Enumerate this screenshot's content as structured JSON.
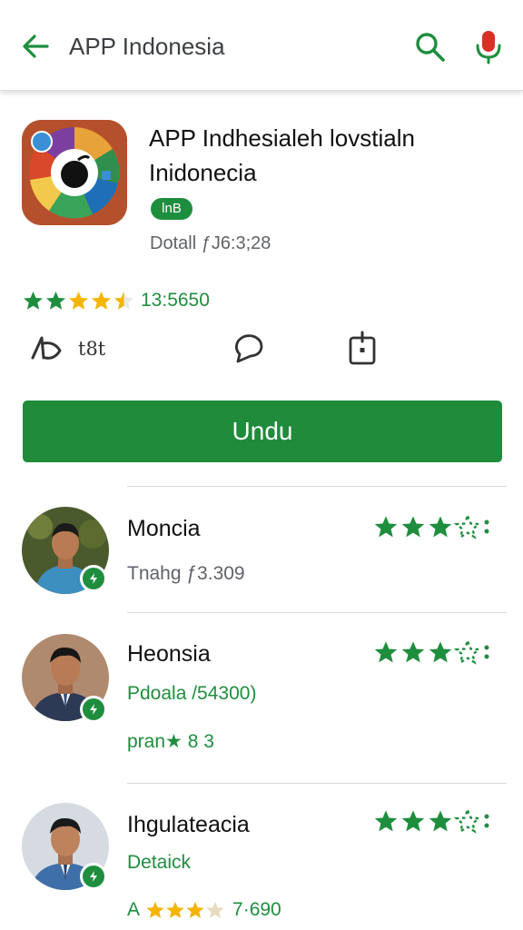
{
  "appbar": {
    "title": "APP Indonesia",
    "back_icon": "arrow-back-icon",
    "search_icon": "search-icon",
    "mic_icon": "microphone-icon"
  },
  "app": {
    "name": "APP Indhesialeh lovstialn Inidonecia",
    "badge": "lnB",
    "detail": "Dotall ƒJ6:3;28",
    "rating_value": "13:5650",
    "rating_stars": 4.5
  },
  "actions": [
    {
      "icon": "share-icon",
      "label": "t8t"
    },
    {
      "icon": "chat-bubble-icon",
      "label": ""
    },
    {
      "icon": "bookmark-icon",
      "label": ""
    }
  ],
  "install": {
    "label": "Undu"
  },
  "reviews": [
    {
      "name": "Moncia",
      "line1": "Tnahg ƒ3.309",
      "line2": "",
      "stars": 3.5
    },
    {
      "name": "Heonsia",
      "line1": "Pdoala /54300)",
      "line2": "pran★ 8 3",
      "stars": 3.5
    },
    {
      "name": "Ihgulateacia",
      "line1": "Detaick",
      "line2": "7·690",
      "line2_prefix": "A",
      "line2_stars": 3,
      "stars": 3.5
    }
  ],
  "colors": {
    "accent": "#1e8e3e",
    "install_button": "#1f8b3b",
    "star_gold": "#f4b400",
    "mic_red": "#d93025",
    "app_icon_bg": "#b5502c"
  }
}
